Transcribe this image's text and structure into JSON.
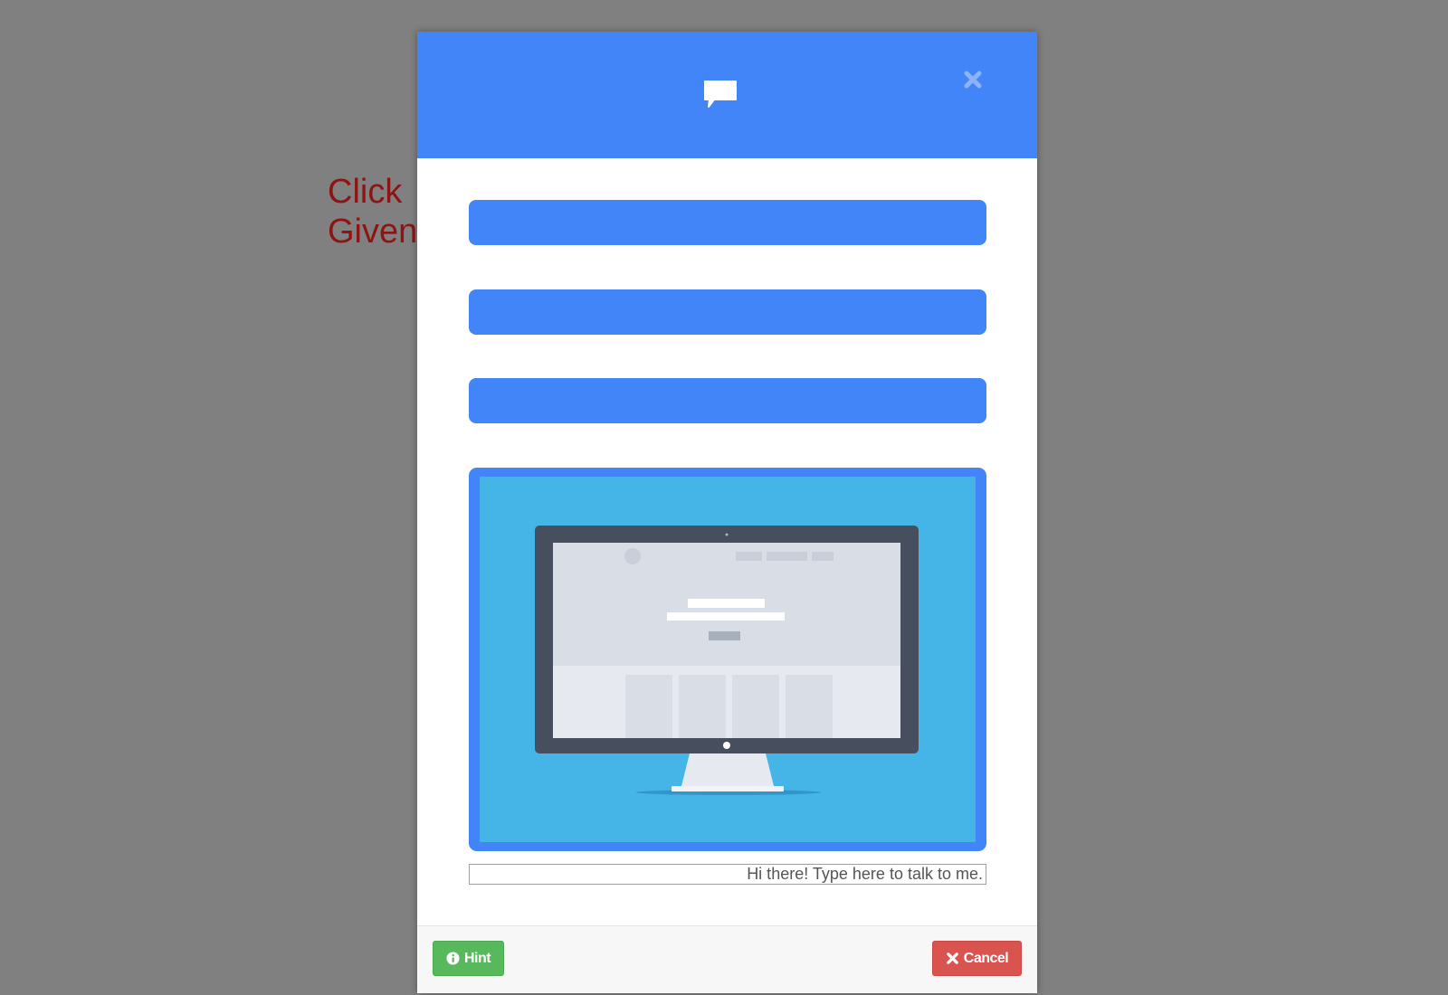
{
  "background": {
    "text_lines": [
      "Click",
      "Given"
    ],
    "color": "#808080",
    "text_color": "#8e1414"
  },
  "modal": {
    "header": {
      "color": "#4285f8",
      "icon": "chat-bubble-icon",
      "close_icon": "close-icon"
    },
    "options": [
      {
        "label": ""
      },
      {
        "label": ""
      },
      {
        "label": ""
      }
    ],
    "image": {
      "description_icon": "monitor-illustration",
      "frame_color": "#4285f8",
      "inner_color": "#45b5e8"
    },
    "chat_input": {
      "placeholder": "Hi there! Type here to talk to me.",
      "value": ""
    },
    "footer": {
      "hint_label": "Hint",
      "hint_icon": "info-circle-icon",
      "hint_color": "#58b85c",
      "cancel_label": "Cancel",
      "cancel_icon": "times-icon",
      "cancel_color": "#d9534f"
    }
  }
}
